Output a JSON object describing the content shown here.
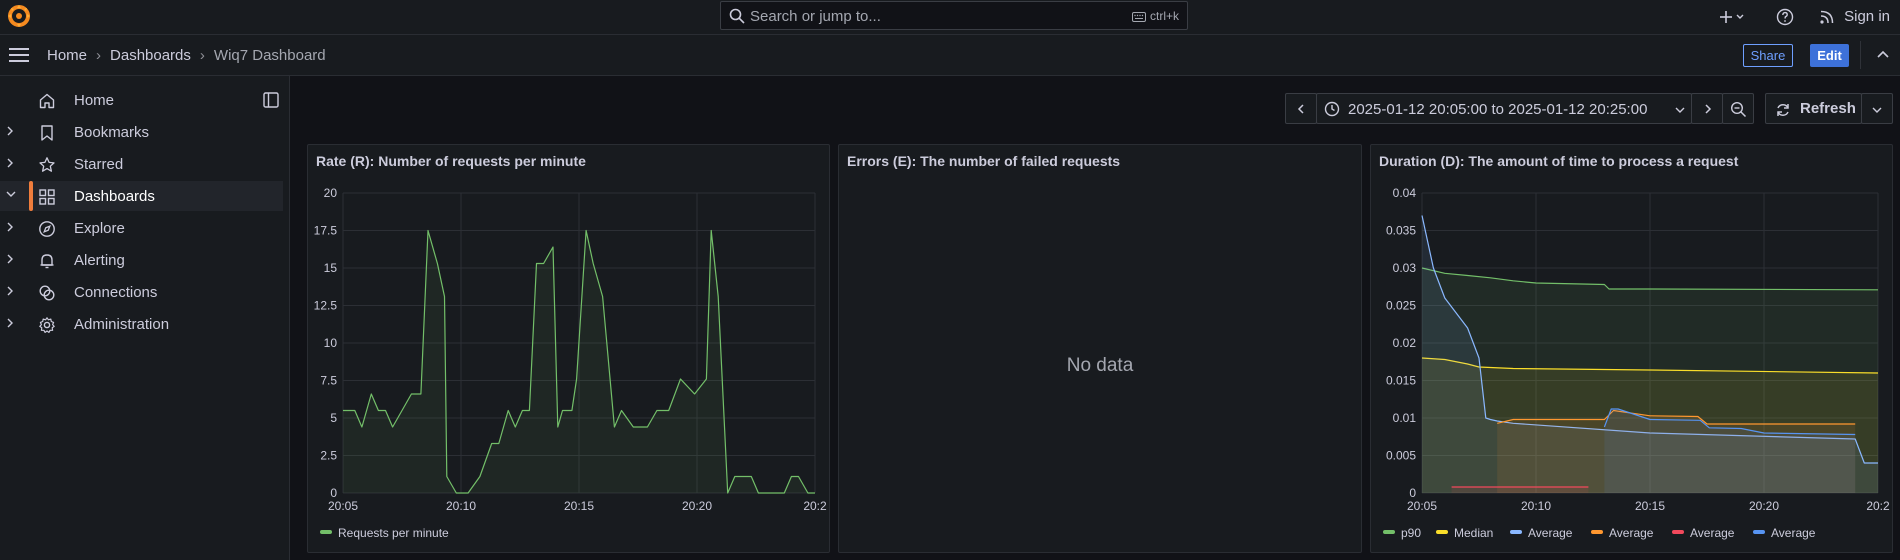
{
  "topbar": {
    "search_placeholder": "Search or jump to...",
    "search_shortcut": "ctrl+k",
    "sign_in": "Sign in"
  },
  "breadcrumb": {
    "home": "Home",
    "dashboards": "Dashboards",
    "current": "Wiq7 Dashboard"
  },
  "actions": {
    "share": "Share",
    "edit": "Edit"
  },
  "sidebar": {
    "items": [
      {
        "label": "Home",
        "icon": "home-icon"
      },
      {
        "label": "Bookmarks",
        "icon": "bookmark-icon"
      },
      {
        "label": "Starred",
        "icon": "star-icon"
      },
      {
        "label": "Dashboards",
        "icon": "dashboards-icon",
        "active": true
      },
      {
        "label": "Explore",
        "icon": "compass-icon"
      },
      {
        "label": "Alerting",
        "icon": "bell-icon"
      },
      {
        "label": "Connections",
        "icon": "connections-icon"
      },
      {
        "label": "Administration",
        "icon": "gear-icon"
      }
    ]
  },
  "timepicker": {
    "range": "2025-01-12 20:05:00 to 2025-01-12 20:25:00",
    "refresh": "Refresh"
  },
  "colors": {
    "accent": "#f07d3c",
    "green": "#73bf69",
    "yellow": "#fade2a",
    "blue": "#8ab8ff",
    "orange": "#ff9830",
    "red": "#f2495c",
    "blue2": "#5794f2"
  },
  "panels": {
    "rate": {
      "title": "Rate (R): Number of requests per minute"
    },
    "errors": {
      "title": "Errors (E): The number of failed requests",
      "empty": "No data"
    },
    "duration": {
      "title": "Duration (D): The amount of time to process a request"
    }
  },
  "chart_data": [
    {
      "type": "area",
      "title": "Rate (R): Number of requests per minute",
      "x_ticks": [
        "20:05",
        "20:10",
        "20:15",
        "20:20",
        "20:2"
      ],
      "y_ticks": [
        "0",
        "2.5",
        "5",
        "7.5",
        "10",
        "12.5",
        "15",
        "17.5",
        "20"
      ],
      "xlim": [
        0,
        20
      ],
      "ylim": [
        0,
        20
      ],
      "series": [
        {
          "name": "Requests per minute",
          "color": "#73bf69",
          "x": [
            0,
            0.5,
            0.8,
            1.2,
            1.5,
            1.8,
            2.1,
            2.5,
            2.9,
            3.3,
            3.6,
            4.0,
            4.3,
            4.4,
            4.8,
            5.3,
            5.8,
            6.3,
            6.6,
            7.0,
            7.3,
            7.6,
            7.9,
            8.2,
            8.5,
            8.9,
            9.1,
            9.3,
            9.7,
            9.9,
            10.3,
            10.6,
            11.0,
            11.5,
            11.8,
            12.3,
            12.6,
            12.9,
            13.3,
            13.8,
            14.3,
            14.9,
            15.4,
            15.6,
            15.9,
            16.3,
            16.6,
            17.0,
            17.3,
            17.6,
            17.9,
            18.3,
            18.7,
            19.0,
            19.3,
            19.7,
            20.0
          ],
          "y": [
            5.5,
            5.5,
            4.4,
            6.6,
            5.5,
            5.5,
            4.4,
            5.5,
            6.6,
            6.6,
            17.5,
            15.3,
            13.1,
            1.1,
            0,
            0,
            1.1,
            3.3,
            3.3,
            5.5,
            4.4,
            5.5,
            5.5,
            15.3,
            15.3,
            16.4,
            4.4,
            5.5,
            5.5,
            7.6,
            17.5,
            15.3,
            13.1,
            4.4,
            5.5,
            4.4,
            4.4,
            4.4,
            5.5,
            5.5,
            7.6,
            6.6,
            7.6,
            17.5,
            13.1,
            0,
            1.1,
            1.1,
            1.1,
            0,
            0,
            0,
            0,
            1.1,
            1.1,
            0,
            0
          ]
        }
      ]
    },
    {
      "type": "line",
      "title": "Duration (D): The amount of time to process a request",
      "x_ticks": [
        "20:05",
        "20:10",
        "20:15",
        "20:20",
        "20:2"
      ],
      "y_ticks": [
        "0",
        "0.005",
        "0.01",
        "0.015",
        "0.02",
        "0.025",
        "0.03",
        "0.035",
        "0.04"
      ],
      "xlim": [
        0,
        20
      ],
      "ylim": [
        0,
        0.04
      ],
      "series": [
        {
          "name": "p90",
          "color": "#73bf69",
          "x": [
            0,
            1,
            2,
            3,
            4,
            5,
            8,
            8.2,
            10,
            20
          ],
          "y": [
            0.03,
            0.0293,
            0.029,
            0.0287,
            0.0283,
            0.028,
            0.0278,
            0.0272,
            0.0272,
            0.0271
          ]
        },
        {
          "name": "Median",
          "color": "#fade2a",
          "x": [
            0,
            1,
            2,
            2.5,
            4,
            10,
            20
          ],
          "y": [
            0.018,
            0.0178,
            0.0172,
            0.0168,
            0.0166,
            0.0164,
            0.016
          ]
        },
        {
          "name": "Average",
          "color": "#8ab8ff",
          "x": [
            0,
            0.5,
            1,
            1.5,
            2,
            2.5,
            2.8,
            3.0,
            3.3,
            4,
            10,
            19,
            19.4,
            20
          ],
          "y": [
            0.037,
            0.03,
            0.026,
            0.024,
            0.022,
            0.018,
            0.01,
            0.0098,
            0.0096,
            0.0093,
            0.008,
            0.0072,
            0.004,
            0.004
          ]
        },
        {
          "name": "Average",
          "color": "#ff9830",
          "x": [
            3.3,
            4,
            8,
            8.4,
            10,
            12.1,
            12.5,
            19
          ],
          "y": [
            0.0093,
            0.0098,
            0.0098,
            0.011,
            0.0103,
            0.0102,
            0.0092,
            0.0092
          ]
        },
        {
          "name": "Average",
          "color": "#f2495c",
          "x": [
            1.3,
            7.3
          ],
          "y": [
            0.0008,
            0.0008
          ]
        },
        {
          "name": "Average",
          "color": "#5794f2",
          "x": [
            8,
            8.3,
            8.6,
            10,
            12.2,
            12.6,
            14,
            15,
            19
          ],
          "y": [
            0.0088,
            0.0112,
            0.0112,
            0.0098,
            0.0097,
            0.0087,
            0.0086,
            0.008,
            0.0078
          ]
        }
      ]
    }
  ]
}
